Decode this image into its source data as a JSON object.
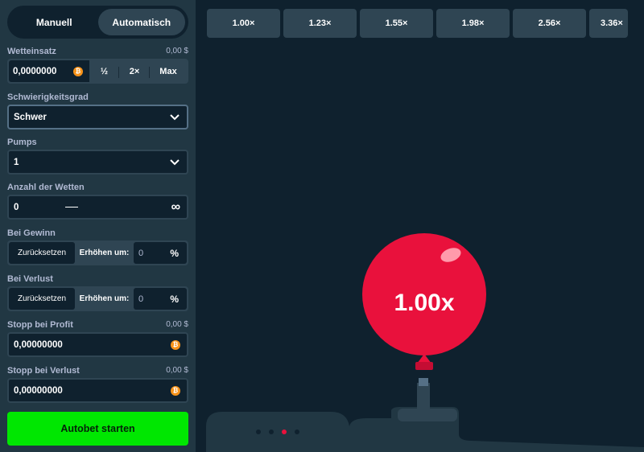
{
  "modes": {
    "manual": "Manuell",
    "auto": "Automatisch"
  },
  "bet": {
    "label": "Wetteinsatz",
    "amount_usd": "0,00 $",
    "value": "0,0000000",
    "half": "½",
    "double": "2×",
    "max": "Max"
  },
  "difficulty": {
    "label": "Schwierigkeitsgrad",
    "value": "Schwer"
  },
  "pumps": {
    "label": "Pumps",
    "value": "1"
  },
  "num_bets": {
    "label": "Anzahl der Wetten",
    "value": "0",
    "infinity": "∞"
  },
  "on_win": {
    "label": "Bei Gewinn",
    "reset": "Zurücksetzen",
    "increase_label": "Erhöhen um:",
    "value": "0",
    "unit": "%"
  },
  "on_loss": {
    "label": "Bei Verlust",
    "reset": "Zurücksetzen",
    "increase_label": "Erhöhen um:",
    "value": "0",
    "unit": "%"
  },
  "stop_profit": {
    "label": "Stopp bei Profit",
    "amount_usd": "0,00 $",
    "value": "0,00000000"
  },
  "stop_loss": {
    "label": "Stopp bei Verlust",
    "amount_usd": "0,00 $",
    "value": "0,00000000"
  },
  "start_button": "Autobet starten",
  "coin_symbol": "₿",
  "multipliers": [
    "1.00×",
    "1.23×",
    "1.55×",
    "1.98×",
    "2.56×",
    "3.36×"
  ],
  "balloon": {
    "label": "1.00x",
    "color": "#e9113c"
  },
  "pagination": {
    "count": 4,
    "active_index": 2
  },
  "colors": {
    "accent_green": "#00e701",
    "panel": "#213743",
    "background": "#0f212e",
    "input_border": "#2f4553"
  }
}
